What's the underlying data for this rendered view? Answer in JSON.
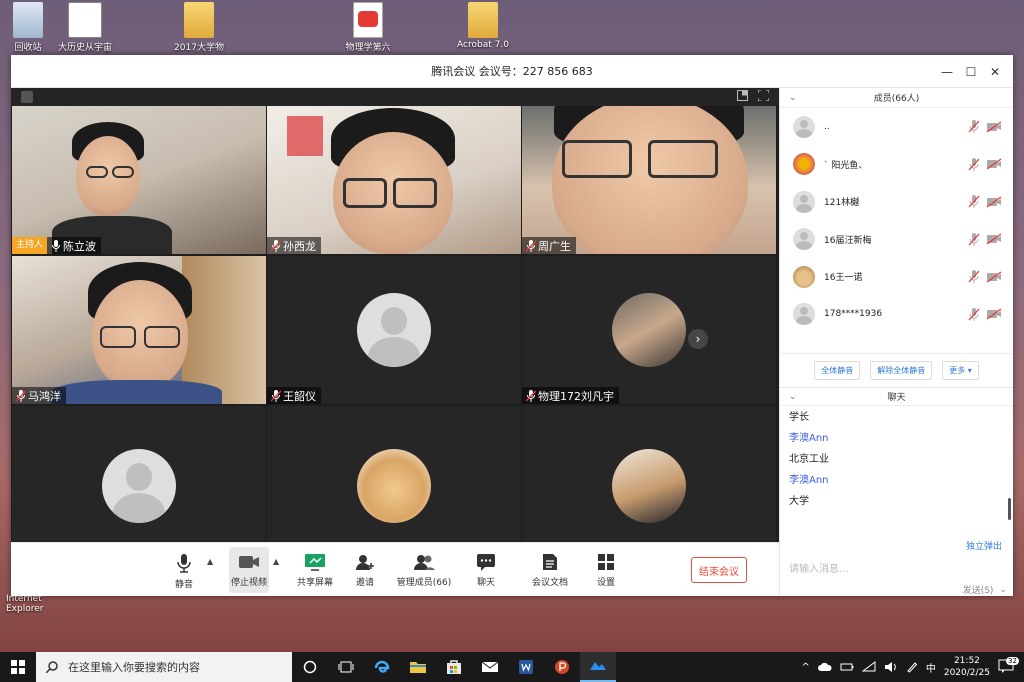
{
  "desktop": {
    "icons": [
      {
        "label": "回收站"
      },
      {
        "label": "大历史从宇宙"
      },
      {
        "label": "2017大学物"
      },
      {
        "label": "物理学第六"
      },
      {
        "label": "Acrobat 7.0"
      }
    ],
    "side_label": "Internet Explorer"
  },
  "window": {
    "title": "腾讯会议 会议号：227 856 683",
    "controls": {
      "minimize": "—",
      "maximize": "☐",
      "close": "✕"
    }
  },
  "video": {
    "host_badge": "主持人",
    "tiles": [
      {
        "name": "陈立波",
        "host": true,
        "muted": false
      },
      {
        "name": "孙西龙",
        "muted": true
      },
      {
        "name": "周广生",
        "muted": true
      },
      {
        "name": "马鸿洋",
        "muted": true
      },
      {
        "name": "王韶仪",
        "muted": true
      },
      {
        "name": "物理172刘凡宇",
        "muted": true
      },
      {
        "name": "",
        "muted": true
      },
      {
        "name": "",
        "muted": true
      },
      {
        "name": "",
        "muted": true
      }
    ],
    "next_arrow": "›"
  },
  "toolbar": {
    "mute": "静音",
    "stop_video": "停止视频",
    "share": "共享屏幕",
    "invite": "邀请",
    "manage": "管理成员(66)",
    "chat": "聊天",
    "docs": "会议文档",
    "settings": "设置",
    "end": "结束会议"
  },
  "members": {
    "title": "成员(66人)",
    "list": [
      {
        "name": ".."
      },
      {
        "name": "` 阳光鱼、"
      },
      {
        "name": "121林樾"
      },
      {
        "name": "16届汪新梅"
      },
      {
        "name": "16王一诺"
      },
      {
        "name": "178****1936"
      }
    ],
    "actions": {
      "mute_all": "全体静音",
      "unmute_all": "解除全体静音",
      "more": "更多 ▾"
    }
  },
  "chat": {
    "title": "聊天",
    "messages": [
      {
        "text": "学长",
        "sender": false
      },
      {
        "text": "李澳Ann",
        "sender": true
      },
      {
        "text": "北京工业",
        "sender": false
      },
      {
        "text": "李澳Ann",
        "sender": true
      },
      {
        "text": "大学",
        "sender": false
      }
    ],
    "popout": "独立弹出",
    "input_placeholder": "请输入消息...",
    "send": "发送(S)",
    "send_menu": "⌄"
  },
  "taskbar": {
    "search_placeholder": "在这里输入你要搜索的内容",
    "ime": "中",
    "time": "21:52",
    "date": "2020/2/25",
    "notifications": "32"
  },
  "colors": {
    "accent": "#2d7bd8",
    "host_badge": "#f5a623",
    "end_meeting": "#e74c3c",
    "chat_sender": "#3b5bdb"
  }
}
